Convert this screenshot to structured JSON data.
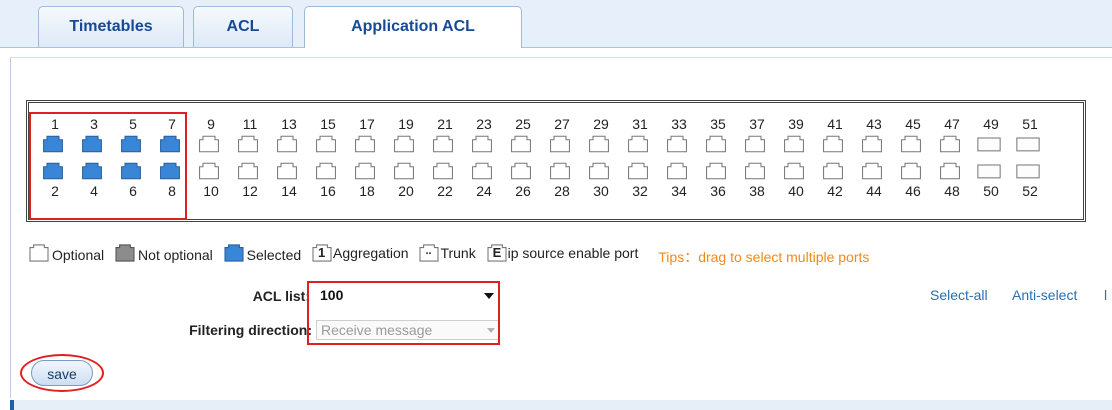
{
  "tabs": [
    {
      "label": "Timetables",
      "active": false
    },
    {
      "label": "ACL",
      "active": false
    },
    {
      "label": "Application ACL",
      "active": true
    }
  ],
  "ports": {
    "odd": [
      "1",
      "3",
      "5",
      "7",
      "9",
      "11",
      "13",
      "15",
      "17",
      "19",
      "21",
      "23",
      "25",
      "27",
      "29",
      "31",
      "33",
      "35",
      "37",
      "39",
      "41",
      "43",
      "45",
      "47",
      "49",
      "51"
    ],
    "even": [
      "2",
      "4",
      "6",
      "8",
      "10",
      "12",
      "14",
      "16",
      "18",
      "20",
      "22",
      "24",
      "26",
      "28",
      "30",
      "32",
      "34",
      "36",
      "38",
      "40",
      "42",
      "44",
      "46",
      "48",
      "50",
      "52"
    ],
    "selected": [
      "1",
      "2",
      "3",
      "4",
      "5",
      "6",
      "7",
      "8"
    ],
    "optional_fiber": [
      "49",
      "50",
      "51",
      "52"
    ]
  },
  "legend": {
    "optional": "Optional",
    "not_optional": "Not optional",
    "selected": "Selected",
    "aggregation": "Aggregation",
    "aggregation_glyph": "1",
    "trunk": "Trunk",
    "trunk_glyph": "..",
    "ip_source": "ip source enable port",
    "ip_source_glyph": "E",
    "tips": "Tips：drag to select multiple ports"
  },
  "form": {
    "acl_list_label": "ACL list:",
    "acl_list_value": "100",
    "filtering_label": "Filtering direction:",
    "filtering_value": "Receive message"
  },
  "links": {
    "select_all": "Select-all",
    "anti_select": "Anti-select",
    "extra": "l"
  },
  "save_label": "save",
  "colors": {
    "selected_port": "#3a86d6",
    "tab_text": "#174a93",
    "tips": "#f08a1c",
    "highlight": "#e02020"
  }
}
